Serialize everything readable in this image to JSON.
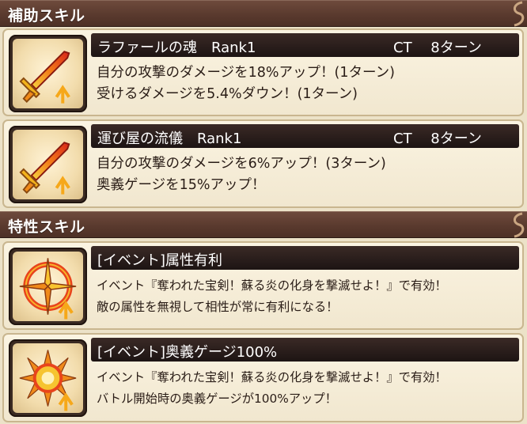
{
  "sections": [
    {
      "label": "補助スキル"
    },
    {
      "label": "特性スキル"
    }
  ],
  "support_skills": [
    {
      "name": "ラファールの魂　Rank1",
      "ct": "CT　 8ターン",
      "lines": [
        "自分の攻撃のダメージを18%アップ！(1ターン)",
        "受けるダメージを5.4%ダウン！(1ターン)"
      ],
      "icon": "sword-icon"
    },
    {
      "name": "運び屋の流儀　Rank1",
      "ct": "CT　 8ターン",
      "lines": [
        "自分の攻撃のダメージを6%アップ！(3ターン)",
        "奥義ゲージを15%アップ！"
      ],
      "icon": "sword-icon"
    }
  ],
  "trait_skills": [
    {
      "name": "[イベント]属性有利",
      "lines": [
        "イベント『奪われた宝剣！蘇る炎の化身を撃滅せよ！』で有効！",
        "敵の属性を無視して相性が常に有利になる！"
      ],
      "icon": "compass-icon"
    },
    {
      "name": "[イベント]奥義ゲージ100%",
      "lines": [
        "イベント『奪われた宝剣！蘇る炎の化身を撃滅せよ！』で有効！",
        "バトル開始時の奥義ゲージが100%アップ！"
      ],
      "icon": "sun-icon"
    }
  ],
  "colors": {
    "header": "#5a3a2e",
    "title_bar": "#1d1413",
    "card": "#f5ecd6",
    "accent": "#e8441c"
  }
}
